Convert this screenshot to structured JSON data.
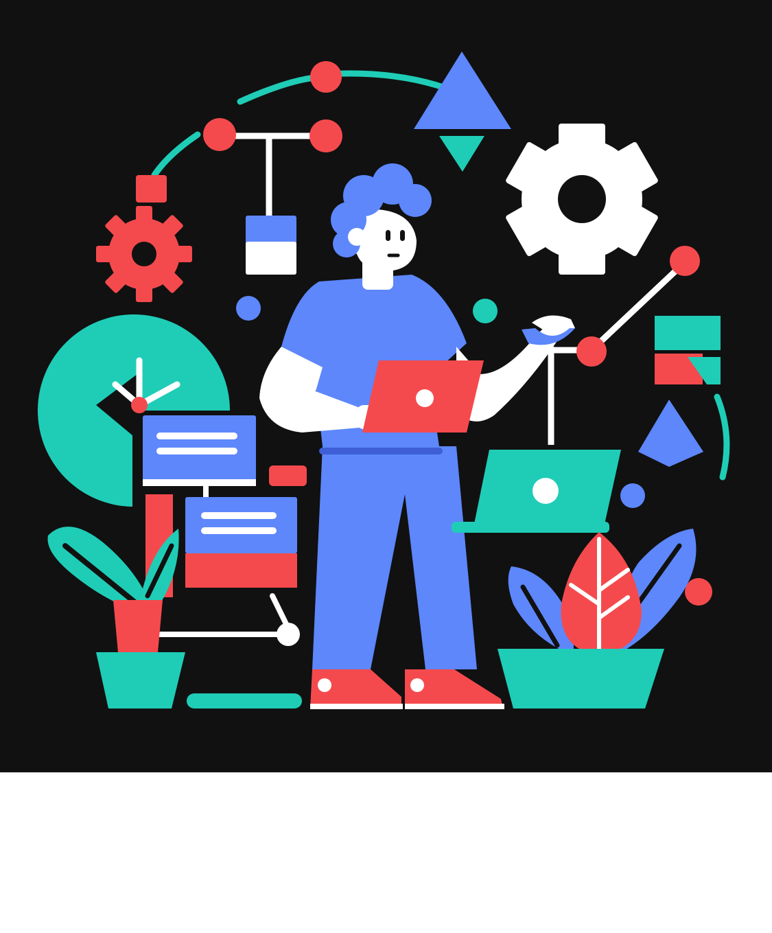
{
  "scene": {
    "subject": "person-holding-laptop",
    "palette": {
      "background": "#111111",
      "blue": "#5D87FB",
      "red": "#F54A4D",
      "teal": "#1FCDB7",
      "white": "#FFFFFF",
      "footer": "#FFFFFF"
    },
    "icons": [
      "gear-icon",
      "gear-icon",
      "triangle-icon",
      "network-node-icon",
      "laptop-icon",
      "plant-icon",
      "pie-chart-icon"
    ]
  }
}
